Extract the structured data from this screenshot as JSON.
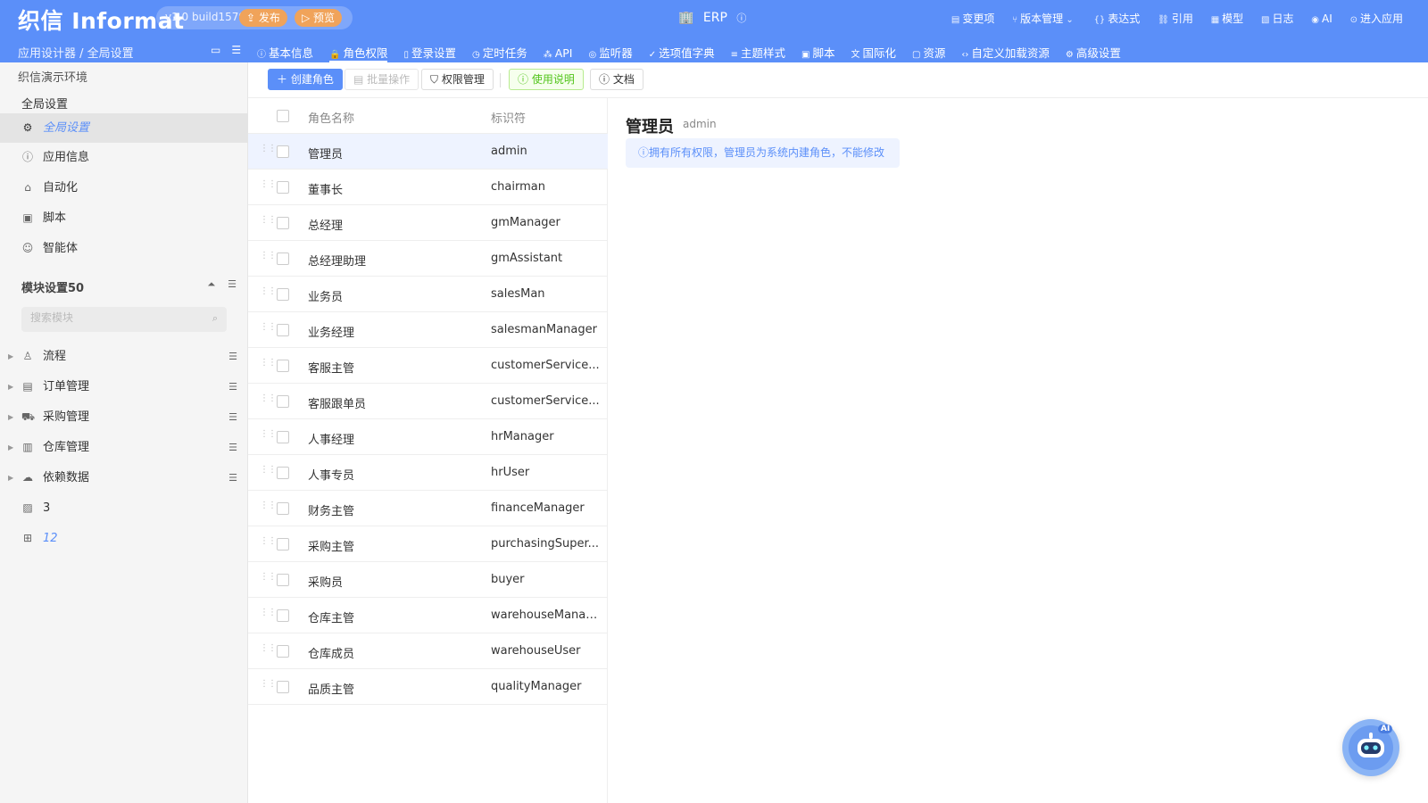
{
  "header": {
    "logo": "织信 Informat",
    "version": "v1.0 build1579",
    "publish_label": "发布",
    "preview_label": "预览",
    "app_name": "ERP",
    "links": [
      {
        "icon": "diff-icon",
        "label": "变更项"
      },
      {
        "icon": "branch-icon",
        "label": "版本管理"
      },
      {
        "icon": "braces-icon",
        "label": "表达式"
      },
      {
        "icon": "link-icon",
        "label": "引用"
      },
      {
        "icon": "grid-icon",
        "label": "模型"
      },
      {
        "icon": "log-icon",
        "label": "日志"
      },
      {
        "icon": "ai-icon",
        "label": "AI"
      },
      {
        "icon": "enter-icon",
        "label": "进入应用"
      }
    ],
    "breadcrumb": "应用设计器 / 全局设置",
    "tabs": [
      {
        "icon": "info-icon",
        "label": "基本信息"
      },
      {
        "icon": "lock-icon",
        "label": "角色权限"
      },
      {
        "icon": "login-icon",
        "label": "登录设置"
      },
      {
        "icon": "clock-icon",
        "label": "定时任务"
      },
      {
        "icon": "api-icon",
        "label": "API"
      },
      {
        "icon": "eye-icon",
        "label": "监听器"
      },
      {
        "icon": "check-icon",
        "label": "选项值字典"
      },
      {
        "icon": "theme-icon",
        "label": "主题样式"
      },
      {
        "icon": "script-icon",
        "label": "脚本"
      },
      {
        "icon": "translate-icon",
        "label": "国际化"
      },
      {
        "icon": "file-icon",
        "label": "资源"
      },
      {
        "icon": "code-icon",
        "label": "自定义加载资源"
      },
      {
        "icon": "gear-icon",
        "label": "高级设置"
      }
    ],
    "active_tab": "角色权限"
  },
  "sidebar": {
    "env": "织信演示环境",
    "section_title": "全局设置",
    "items": [
      {
        "icon": "gear-icon",
        "label": "全局设置",
        "active": true
      },
      {
        "icon": "info-icon",
        "label": "应用信息"
      },
      {
        "icon": "robot-icon",
        "label": "自动化"
      },
      {
        "icon": "script-icon",
        "label": "脚本"
      },
      {
        "icon": "agent-icon",
        "label": "智能体"
      }
    ],
    "module_title": "模块设置50",
    "search_placeholder": "搜索模块",
    "modules": [
      {
        "icon": "user-icon",
        "label": "流程",
        "expandable": true
      },
      {
        "icon": "list-icon",
        "label": "订单管理",
        "expandable": true
      },
      {
        "icon": "cart-icon",
        "label": "采购管理",
        "expandable": true
      },
      {
        "icon": "warehouse-icon",
        "label": "仓库管理",
        "expandable": true
      },
      {
        "icon": "cloud-icon",
        "label": "依赖数据",
        "expandable": true
      },
      {
        "icon": "table-icon",
        "label": "3"
      },
      {
        "icon": "grid-icon",
        "label": "12",
        "blue": true
      }
    ]
  },
  "toolbar": {
    "create_label": "创建角色",
    "batch_label": "批量操作",
    "perm_label": "权限管理",
    "help_label": "使用说明",
    "doc_label": "文档"
  },
  "table": {
    "col_name": "角色名称",
    "col_key": "标识符",
    "rows": [
      {
        "name": "管理员",
        "key": "admin"
      },
      {
        "name": "董事长",
        "key": "chairman"
      },
      {
        "name": "总经理",
        "key": "gmManager"
      },
      {
        "name": "总经理助理",
        "key": "gmAssistant"
      },
      {
        "name": "业务员",
        "key": "salesMan"
      },
      {
        "name": "业务经理",
        "key": "salesmanManager"
      },
      {
        "name": "客服主管",
        "key": "customerService..."
      },
      {
        "name": "客服跟单员",
        "key": "customerService..."
      },
      {
        "name": "人事经理",
        "key": "hrManager"
      },
      {
        "name": "人事专员",
        "key": "hrUser"
      },
      {
        "name": "财务主管",
        "key": "financeManager"
      },
      {
        "name": "采购主管",
        "key": "purchasingSuper..."
      },
      {
        "name": "采购员",
        "key": "buyer"
      },
      {
        "name": "仓库主管",
        "key": "warehouseManager"
      },
      {
        "name": "仓库成员",
        "key": "warehouseUser"
      },
      {
        "name": "品质主管",
        "key": "qualityManager"
      }
    ],
    "selected_index": 0
  },
  "detail": {
    "title": "管理员",
    "key": "admin",
    "notice": "拥有所有权限，管理员为系统内建角色，不能修改"
  },
  "assistant": {
    "badge": "AI"
  },
  "colors": {
    "primary": "#5b8ff9",
    "publish": "#f0a35a",
    "green": "#52c41a"
  }
}
